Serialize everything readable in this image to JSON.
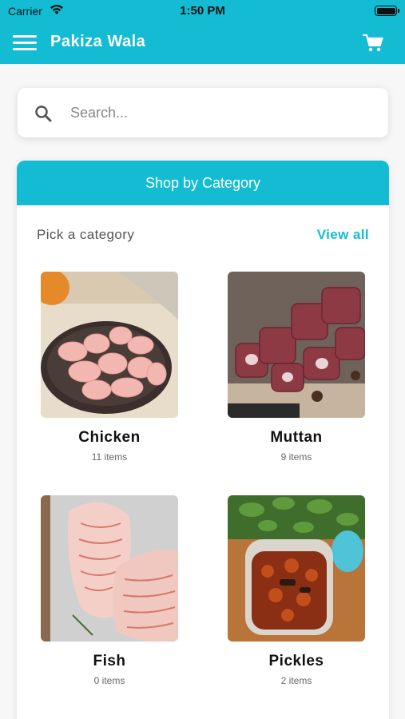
{
  "status_bar": {
    "carrier": "Carrier",
    "time": "1:50 PM"
  },
  "app_bar": {
    "title": "Pakiza Wala",
    "menu_icon": "hamburger-menu-icon",
    "cart_icon": "shopping-cart-icon"
  },
  "search": {
    "placeholder": "Search...",
    "icon": "search-icon"
  },
  "category_section": {
    "header": "Shop by Category",
    "pick_label": "Pick a category",
    "view_all": "View all",
    "categories": [
      {
        "name": "Chicken",
        "count": "11 items"
      },
      {
        "name": "Muttan",
        "count": "9 items"
      },
      {
        "name": "Fish",
        "count": "0 items"
      },
      {
        "name": "Pickles",
        "count": "2 items"
      }
    ]
  },
  "colors": {
    "accent": "#13bcd3",
    "background": "#f7f7f7"
  }
}
